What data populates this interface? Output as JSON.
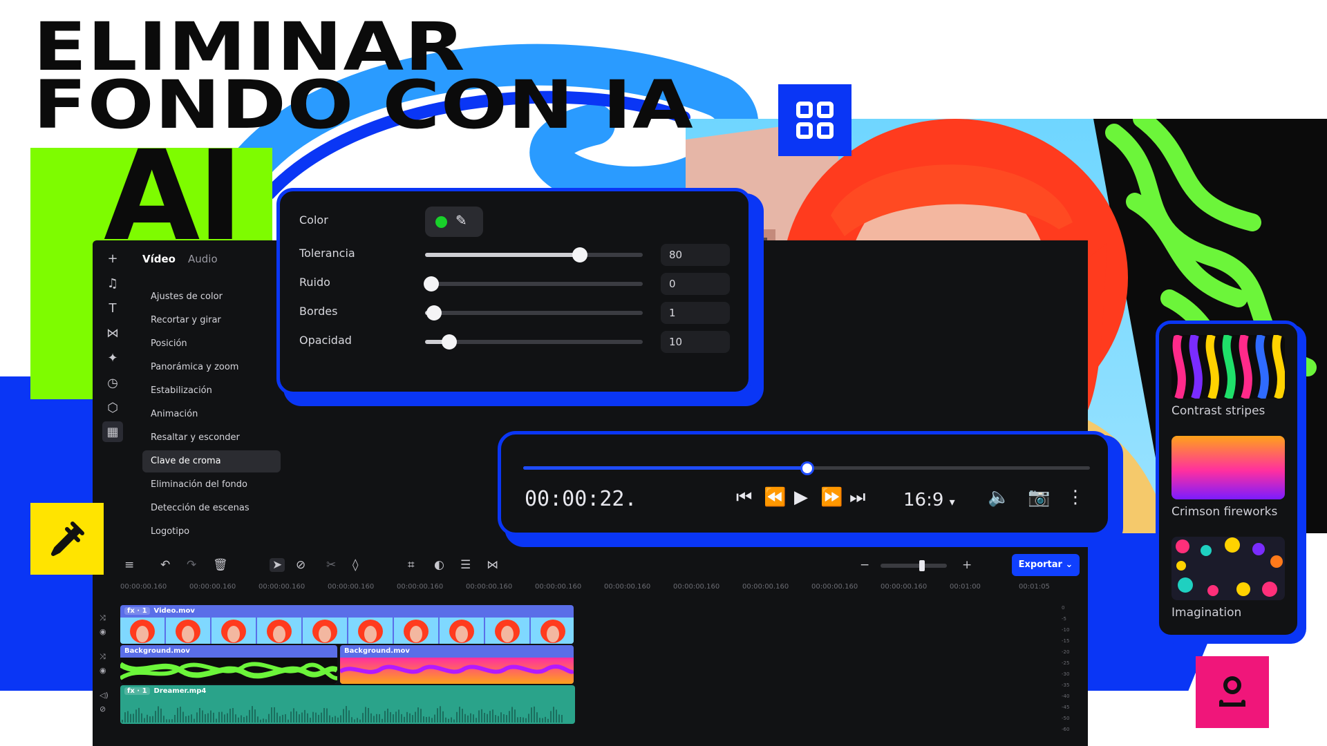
{
  "headline": {
    "line1": "ELIMINAR",
    "line2": "FONDO CON IA",
    "ai": "AI"
  },
  "colors": {
    "brand_blue": "#0a36f5",
    "lime": "#7efc00",
    "yellow": "#ffe400",
    "pink": "#f0167a",
    "panel_bg": "#111214",
    "export_blue": "#1040ff"
  },
  "tiles": {
    "qr_icon": "qr-grid-icon",
    "eyedropper_icon": "eyedropper-icon",
    "user_icon": "user-icon"
  },
  "editor": {
    "tabs": {
      "video": "Vídeo",
      "audio": "Audio"
    },
    "rail_icons": [
      "plus-icon",
      "music-note-icon",
      "text-icon",
      "transition-icon",
      "magic-wand-icon",
      "clock-icon",
      "sticker-icon",
      "apps-grid-icon"
    ],
    "menu": [
      "Ajustes de color",
      "Recortar y girar",
      "Posición",
      "Panorámica y zoom",
      "Estabilización",
      "Animación",
      "Resaltar y esconder",
      "Clave de croma",
      "Eliminación del fondo",
      "Detección de escenas",
      "Logotipo"
    ],
    "menu_active_index": 7
  },
  "chroma": {
    "color_label": "Color",
    "swatch_color": "#18d12a",
    "rows": [
      {
        "label": "Tolerancia",
        "value": "80",
        "fraction": 0.71
      },
      {
        "label": "Ruido",
        "value": "0",
        "fraction": 0.03
      },
      {
        "label": "Bordes",
        "value": "1",
        "fraction": 0.04
      },
      {
        "label": "Opacidad",
        "value": "10",
        "fraction": 0.11
      }
    ]
  },
  "player": {
    "timecode": "00:00:22.",
    "progress": 0.5,
    "aspect": "16:9",
    "icons": [
      "skip-start-icon",
      "rewind-icon",
      "play-icon",
      "fast-forward-icon",
      "skip-end-icon",
      "volume-icon",
      "camera-icon",
      "more-vertical-icon"
    ]
  },
  "effects": [
    {
      "name": "Contrast stripes"
    },
    {
      "name": "Crimson fireworks"
    },
    {
      "name": "Imagination"
    }
  ],
  "timeline": {
    "export_label": "Exportar",
    "ruler": [
      "00:00:00.160",
      "00:00:00.160",
      "00:00:00.160",
      "00:00:00.160",
      "00:00:00.160",
      "00:00:00.160",
      "00:00:00.160",
      "00:00:00.160",
      "00:00:00.160",
      "00:00:00.160",
      "00:00:00.160",
      "00:00:00.160",
      "00:01:00",
      "00:01:05"
    ],
    "video_clip": {
      "badge": "fx · 1",
      "name": "Video.mov"
    },
    "bg_clip_1": {
      "name": "Background.mov"
    },
    "bg_clip_2": {
      "name": "Background.mov"
    },
    "audio_clip": {
      "badge": "fx · 1",
      "name": "Dreamer.mp4"
    },
    "meter_db": [
      "0",
      "-5",
      "-10",
      "-15",
      "-20",
      "-25",
      "-30",
      "-35",
      "-40",
      "-45",
      "-50",
      "-60"
    ]
  }
}
